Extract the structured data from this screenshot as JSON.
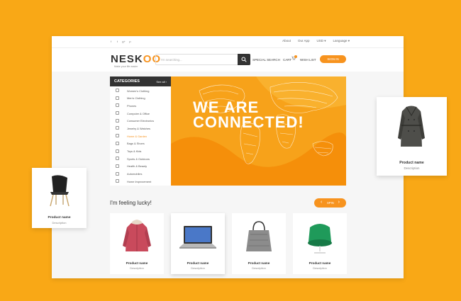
{
  "topbar": {
    "social": [
      "f",
      "t",
      "g+",
      "p"
    ],
    "links": [
      "About",
      "Our App",
      "USD ▾",
      "Language ▾"
    ]
  },
  "header": {
    "logo_prefix": "NESK",
    "logo_oo": "OO",
    "tagline": "Make your life easier",
    "search_placeholder": "I'm searching...",
    "special_search": "SPECIAL SEARCH",
    "cart": "CART",
    "wish_list": "WISH LIST",
    "signin": "SIGN IN"
  },
  "categories": {
    "title": "CATEGORIES",
    "see_all": "See all ›",
    "items": [
      {
        "label": "Women's Clothing",
        "icon": "dress-icon"
      },
      {
        "label": "Men's Clothing",
        "icon": "shirt-icon"
      },
      {
        "label": "Phones",
        "icon": "phone-icon"
      },
      {
        "label": "Computer & Office",
        "icon": "computer-icon"
      },
      {
        "label": "Consumer Electronics",
        "icon": "camera-icon"
      },
      {
        "label": "Jewelry & Watches",
        "icon": "watch-icon"
      },
      {
        "label": "Home & Garden",
        "icon": "home-icon"
      },
      {
        "label": "Bags & Shoes",
        "icon": "bag-icon"
      },
      {
        "label": "Toys & Kids",
        "icon": "toy-icon"
      },
      {
        "label": "Sports & Outdoors",
        "icon": "sport-icon"
      },
      {
        "label": "Health & Beauty",
        "icon": "health-icon"
      },
      {
        "label": "Automobiles",
        "icon": "car-icon"
      },
      {
        "label": "Home Improvement",
        "icon": "tools-icon"
      }
    ]
  },
  "banner": {
    "line1": "WE ARE",
    "line2": "CONNECTED!"
  },
  "lucky": {
    "title": "I'm feeling lucky!",
    "spin": "SPIN"
  },
  "products": [
    {
      "name": "Product name",
      "desc": "Description"
    },
    {
      "name": "Product name",
      "desc": "Description"
    },
    {
      "name": "Product name",
      "desc": "Description"
    },
    {
      "name": "Product name",
      "desc": "Description"
    }
  ],
  "float_chair": {
    "name": "Product name",
    "desc": "Description"
  },
  "float_coat": {
    "name": "Product name",
    "desc": "Description"
  },
  "colors": {
    "accent": "#f7931e",
    "background": "#f9a816",
    "dark": "#333333"
  }
}
